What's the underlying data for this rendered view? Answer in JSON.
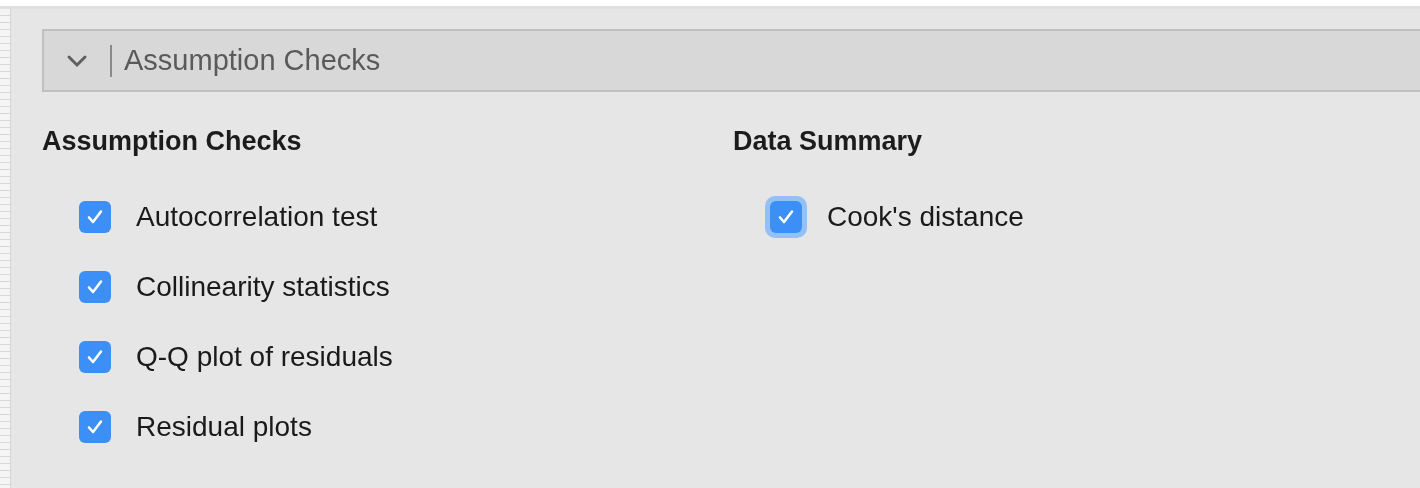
{
  "section_header": {
    "title": "Assumption Checks",
    "expanded": true
  },
  "groups": [
    {
      "title": "Assumption Checks",
      "options": [
        {
          "label": "Autocorrelation test",
          "checked": true,
          "focused": false
        },
        {
          "label": "Collinearity statistics",
          "checked": true,
          "focused": false
        },
        {
          "label": "Q-Q plot of residuals",
          "checked": true,
          "focused": false
        },
        {
          "label": "Residual plots",
          "checked": true,
          "focused": false
        }
      ]
    },
    {
      "title": "Data Summary",
      "options": [
        {
          "label": "Cook's distance",
          "checked": true,
          "focused": true
        }
      ]
    }
  ]
}
